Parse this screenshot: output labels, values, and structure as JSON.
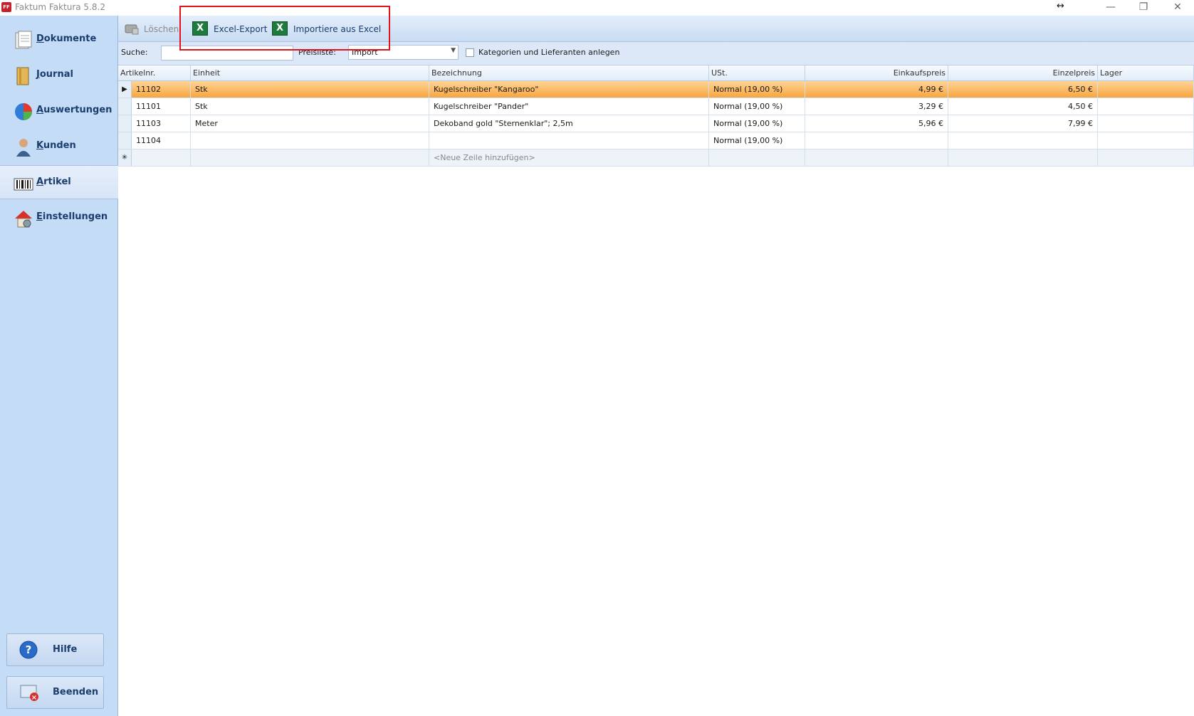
{
  "window": {
    "title": "Faktum Faktura 5.8.2",
    "logo_text": "FF"
  },
  "sidebar": {
    "items": [
      {
        "label": "Dokumente"
      },
      {
        "label": "Journal"
      },
      {
        "label": "Auswertungen"
      },
      {
        "label": "Kunden"
      },
      {
        "label": "Artikel"
      },
      {
        "label": "Einstellungen"
      }
    ],
    "help_label": "Hilfe",
    "exit_label": "Beenden"
  },
  "toolbar": {
    "delete_label": "Löschen",
    "export_label": "Excel-Export",
    "import_label": "Importiere aus Excel"
  },
  "filter": {
    "search_label": "Suche:",
    "search_value": "",
    "pricelist_label": "Preisliste:",
    "pricelist_value": "Import",
    "categories_label": "Kategorien und Lieferanten anlegen"
  },
  "table": {
    "columns": [
      "Artikelnr.",
      "Einheit",
      "Bezeichnung",
      "USt.",
      "Einkaufspreis",
      "Einzelpreis",
      "Lager"
    ],
    "rows": [
      {
        "nr": "11102",
        "einheit": "Stk",
        "bez": "Kugelschreiber \"Kangaroo\"",
        "ust": "Normal (19,00 %)",
        "ek": "4,99 €",
        "ep": "6,50 €",
        "lager": ""
      },
      {
        "nr": "11101",
        "einheit": "Stk",
        "bez": "Kugelschreiber \"Pander\"",
        "ust": "Normal (19,00 %)",
        "ek": "3,29 €",
        "ep": "4,50 €",
        "lager": ""
      },
      {
        "nr": "11103",
        "einheit": "Meter",
        "bez": "Dekoband gold \"Sternenklar\"; 2,5m",
        "ust": "Normal (19,00 %)",
        "ek": "5,96 €",
        "ep": "7,99 €",
        "lager": ""
      },
      {
        "nr": "11104",
        "einheit": "",
        "bez": "",
        "ust": "Normal (19,00 %)",
        "ek": "",
        "ep": "",
        "lager": ""
      }
    ],
    "new_row_text": "<Neue Zeile hinzufügen>",
    "selected_marker": "▶",
    "new_marker": "✳"
  }
}
